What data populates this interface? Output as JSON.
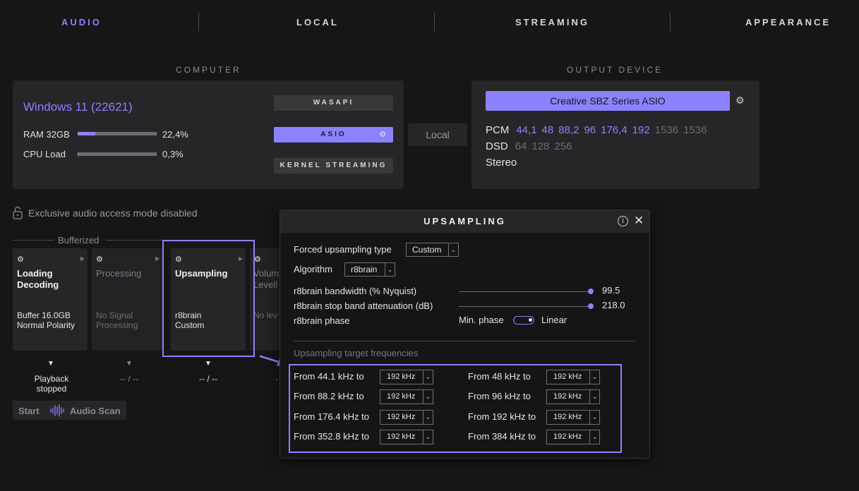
{
  "tabs": [
    {
      "label": "AUDIO",
      "active": true
    },
    {
      "label": "LOCAL",
      "active": false
    },
    {
      "label": "STREAMING",
      "active": false
    },
    {
      "label": "APPEARANCE",
      "active": false
    }
  ],
  "computer": {
    "section_title": "COMPUTER",
    "os_name": "Windows 11 (22621)",
    "ram_label": "RAM 32GB",
    "ram_value": "22,4%",
    "ram_fraction": 0.224,
    "cpu_label": "CPU Load",
    "cpu_value": "0,3%",
    "cpu_fraction": 0.003,
    "modes": [
      {
        "label": "WASAPI",
        "active": false
      },
      {
        "label": "ASIO",
        "active": true
      },
      {
        "label": "KERNEL STREAMING",
        "active": false
      }
    ]
  },
  "local_button": "Local",
  "output": {
    "section_title": "OUTPUT DEVICE",
    "device_name": "Creative SBZ Series ASIO",
    "pcm_label": "PCM",
    "pcm_rates": [
      {
        "v": "44,1",
        "on": true
      },
      {
        "v": "48",
        "on": true
      },
      {
        "v": "88,2",
        "on": true
      },
      {
        "v": "96",
        "on": true
      },
      {
        "v": "176,4",
        "on": true
      },
      {
        "v": "192",
        "on": true
      },
      {
        "v": "1536",
        "on": false
      },
      {
        "v": "1536",
        "on": false
      }
    ],
    "dsd_label": "DSD",
    "dsd_rates": [
      {
        "v": "64",
        "on": false
      },
      {
        "v": "128",
        "on": false
      },
      {
        "v": "256",
        "on": false
      }
    ],
    "channels": "Stereo"
  },
  "exclusive_mode": "Exclusive audio access mode disabled",
  "bufferized_label": "Bufferized",
  "pipeline": [
    {
      "title": "Loading\nDecoding",
      "info": "Buffer 16.0GB\nNormal Polarity",
      "status": "Playback\nstopped",
      "dim": false
    },
    {
      "title": "Processing",
      "info": "No Signal\nProcessing",
      "status": "-- / --",
      "dim": true
    },
    {
      "title": "Upsampling",
      "info": "r8brain\nCustom",
      "status": "-- / --",
      "dim": false
    },
    {
      "title": "Volum\nLevell",
      "info": "No lev",
      "status": "-",
      "dim": true
    }
  ],
  "audio_scan": {
    "start": "Start",
    "label": "Audio Scan"
  },
  "upsampling": {
    "title": "UPSAMPLING",
    "info_icon": "i",
    "forced_label": "Forced upsampling type",
    "forced_value": "Custom",
    "algorithm_label": "Algorithm",
    "algorithm_value": "r8brain",
    "bandwidth_label": "r8brain bandwidth (% Nyquist)",
    "bandwidth_value": "99.5",
    "stopband_label": "r8brain stop band attenuation (dB)",
    "stopband_value": "218.0",
    "phase_label": "r8brain phase",
    "phase_min": "Min. phase",
    "phase_linear": "Linear",
    "targets_title": "Upsampling target frequencies",
    "targets": [
      {
        "from": "From 44.1 kHz to",
        "to": "192 kHz"
      },
      {
        "from": "From 48 kHz to",
        "to": "192 kHz"
      },
      {
        "from": "From 88.2 kHz to",
        "to": "192 kHz"
      },
      {
        "from": "From 96 kHz to",
        "to": "192 kHz"
      },
      {
        "from": "From 176.4 kHz to",
        "to": "192 kHz"
      },
      {
        "from": "From 192 kHz to",
        "to": "192 kHz"
      },
      {
        "from": "From 352.8 kHz to",
        "to": "192 kHz"
      },
      {
        "from": "From 384 kHz to",
        "to": "192 kHz"
      }
    ]
  }
}
